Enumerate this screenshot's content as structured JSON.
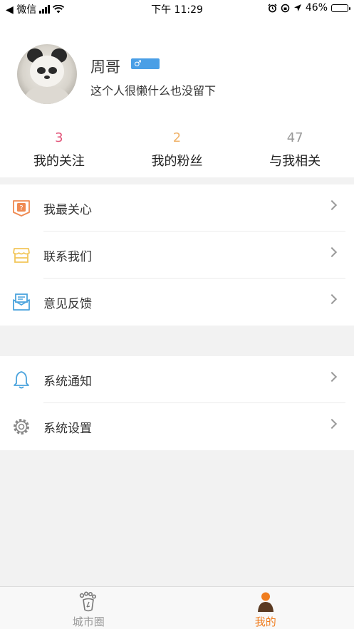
{
  "status_bar": {
    "carrier": "◀ 微信",
    "time": "下午 11:29",
    "battery_text": "46%",
    "battery_level": 0.46
  },
  "profile": {
    "username": "周哥",
    "gender_symbol": "♂",
    "signature": "这个人很懒什么也没留下"
  },
  "stats": [
    {
      "count": "3",
      "label": "我的关注",
      "color": "#e2557a"
    },
    {
      "count": "2",
      "label": "我的粉丝",
      "color": "#f0b36a"
    },
    {
      "count": "47",
      "label": "与我相关",
      "color": "#999999"
    }
  ],
  "menu_group_1": [
    {
      "label": "我最关心",
      "icon": "question-shield-icon",
      "color": "#ef8a52"
    },
    {
      "label": "联系我们",
      "icon": "store-icon",
      "color": "#f2c65a"
    },
    {
      "label": "意见反馈",
      "icon": "mail-icon",
      "color": "#4aa3dd"
    }
  ],
  "menu_group_2": [
    {
      "label": "系统通知",
      "icon": "bell-icon",
      "color": "#4aa3dd"
    },
    {
      "label": "系统设置",
      "icon": "gear-icon",
      "color": "#888888"
    }
  ],
  "tabbar": [
    {
      "label": "城市圈",
      "icon": "footprint-icon",
      "color": "#999999",
      "active": false
    },
    {
      "label": "我的",
      "icon": "person-icon",
      "color": "#f07d1f",
      "active": true
    }
  ],
  "colors": {
    "accent": "#f07d1f",
    "badge_blue": "#4a9fe6",
    "page_bg": "#f2f2f2"
  }
}
